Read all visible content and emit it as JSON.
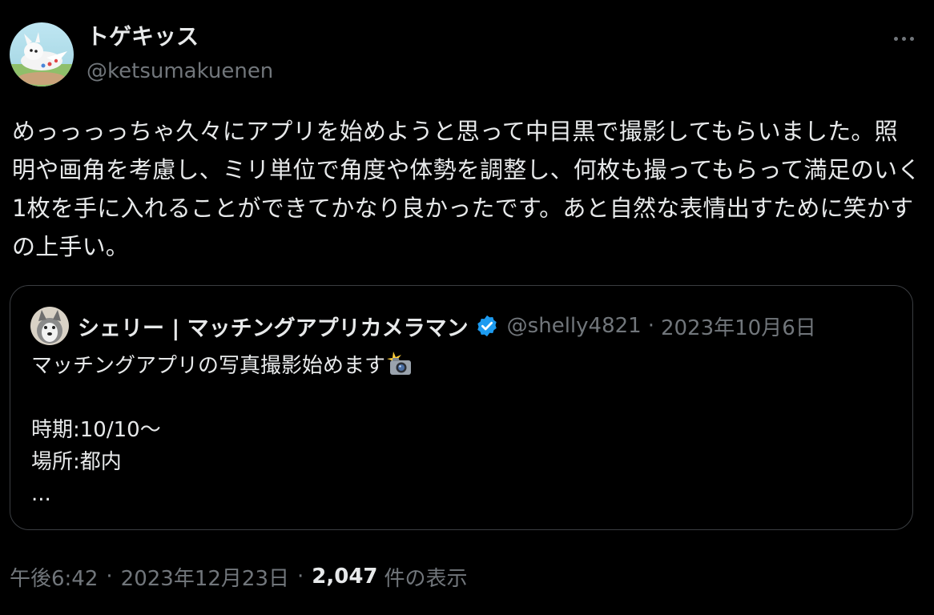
{
  "tweet": {
    "author": {
      "display_name": "トゲキッス",
      "handle": "@ketsumakuenen",
      "avatar_icon": "togekiss-avatar-icon"
    },
    "more_icon": "more-horizontal-icon",
    "text": "めっっっっちゃ久々にアプリを始めようと思って中目黒で撮影してもらいました。照明や画角を考慮し、ミリ単位で角度や体勢を調整し、何枚も撮ってもらって満足のいく1枚を手に入れることができてかなり良かったです。あと自然な表情出すために笑かすの上手い。",
    "quote": {
      "author": {
        "display_name": "シェリー | マッチングアプリカメラマン",
        "handle": "@shelly4821",
        "verified_icon": "verified-badge-icon",
        "avatar_icon": "husky-avatar-icon"
      },
      "separator": "·",
      "date": "2023年10月6日",
      "lines": [
        "マッチングアプリの写真撮影始めます",
        "",
        "時期:10/10〜",
        "場所:都内",
        "..."
      ],
      "emoji_icon": "camera-flash-icon"
    },
    "meta": {
      "time": "午後6:42",
      "separator": "·",
      "date": "2023年12月23日",
      "views_count": "2,047",
      "views_label": "件の表示"
    }
  },
  "colors": {
    "background": "#000000",
    "text_primary": "#e7e9ea",
    "text_secondary": "#71767b",
    "border": "#3a3d41",
    "verified_blue": "#1d9bf0"
  }
}
